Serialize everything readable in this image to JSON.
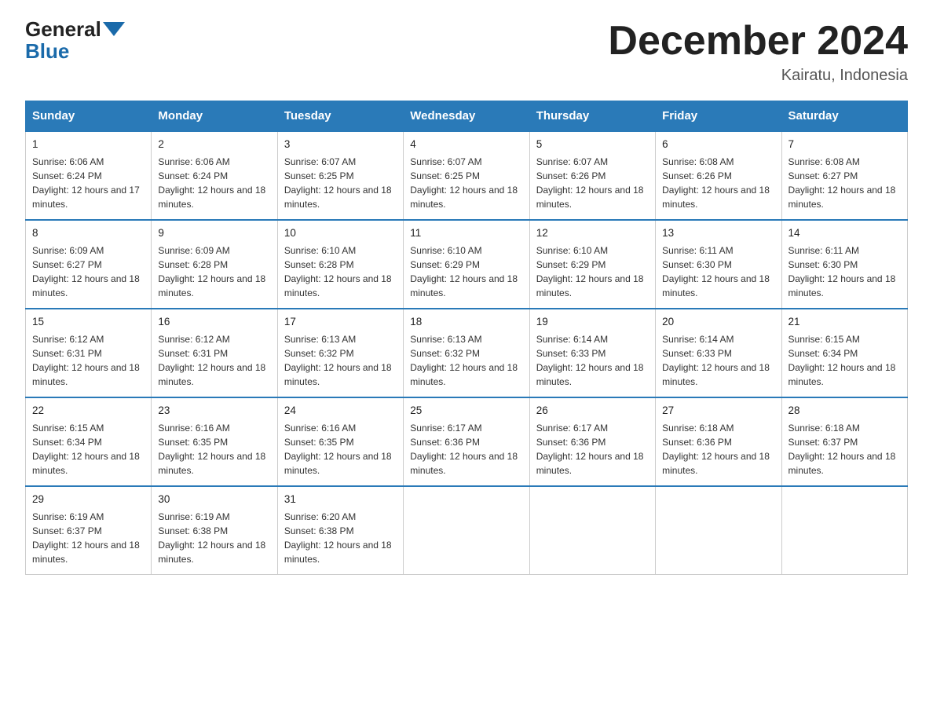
{
  "logo": {
    "general": "General",
    "blue": "Blue"
  },
  "title": "December 2024",
  "subtitle": "Kairatu, Indonesia",
  "weekdays": [
    "Sunday",
    "Monday",
    "Tuesday",
    "Wednesday",
    "Thursday",
    "Friday",
    "Saturday"
  ],
  "weeks": [
    [
      {
        "day": "1",
        "sunrise": "6:06 AM",
        "sunset": "6:24 PM",
        "daylight": "12 hours and 17 minutes."
      },
      {
        "day": "2",
        "sunrise": "6:06 AM",
        "sunset": "6:24 PM",
        "daylight": "12 hours and 18 minutes."
      },
      {
        "day": "3",
        "sunrise": "6:07 AM",
        "sunset": "6:25 PM",
        "daylight": "12 hours and 18 minutes."
      },
      {
        "day": "4",
        "sunrise": "6:07 AM",
        "sunset": "6:25 PM",
        "daylight": "12 hours and 18 minutes."
      },
      {
        "day": "5",
        "sunrise": "6:07 AM",
        "sunset": "6:26 PM",
        "daylight": "12 hours and 18 minutes."
      },
      {
        "day": "6",
        "sunrise": "6:08 AM",
        "sunset": "6:26 PM",
        "daylight": "12 hours and 18 minutes."
      },
      {
        "day": "7",
        "sunrise": "6:08 AM",
        "sunset": "6:27 PM",
        "daylight": "12 hours and 18 minutes."
      }
    ],
    [
      {
        "day": "8",
        "sunrise": "6:09 AM",
        "sunset": "6:27 PM",
        "daylight": "12 hours and 18 minutes."
      },
      {
        "day": "9",
        "sunrise": "6:09 AM",
        "sunset": "6:28 PM",
        "daylight": "12 hours and 18 minutes."
      },
      {
        "day": "10",
        "sunrise": "6:10 AM",
        "sunset": "6:28 PM",
        "daylight": "12 hours and 18 minutes."
      },
      {
        "day": "11",
        "sunrise": "6:10 AM",
        "sunset": "6:29 PM",
        "daylight": "12 hours and 18 minutes."
      },
      {
        "day": "12",
        "sunrise": "6:10 AM",
        "sunset": "6:29 PM",
        "daylight": "12 hours and 18 minutes."
      },
      {
        "day": "13",
        "sunrise": "6:11 AM",
        "sunset": "6:30 PM",
        "daylight": "12 hours and 18 minutes."
      },
      {
        "day": "14",
        "sunrise": "6:11 AM",
        "sunset": "6:30 PM",
        "daylight": "12 hours and 18 minutes."
      }
    ],
    [
      {
        "day": "15",
        "sunrise": "6:12 AM",
        "sunset": "6:31 PM",
        "daylight": "12 hours and 18 minutes."
      },
      {
        "day": "16",
        "sunrise": "6:12 AM",
        "sunset": "6:31 PM",
        "daylight": "12 hours and 18 minutes."
      },
      {
        "day": "17",
        "sunrise": "6:13 AM",
        "sunset": "6:32 PM",
        "daylight": "12 hours and 18 minutes."
      },
      {
        "day": "18",
        "sunrise": "6:13 AM",
        "sunset": "6:32 PM",
        "daylight": "12 hours and 18 minutes."
      },
      {
        "day": "19",
        "sunrise": "6:14 AM",
        "sunset": "6:33 PM",
        "daylight": "12 hours and 18 minutes."
      },
      {
        "day": "20",
        "sunrise": "6:14 AM",
        "sunset": "6:33 PM",
        "daylight": "12 hours and 18 minutes."
      },
      {
        "day": "21",
        "sunrise": "6:15 AM",
        "sunset": "6:34 PM",
        "daylight": "12 hours and 18 minutes."
      }
    ],
    [
      {
        "day": "22",
        "sunrise": "6:15 AM",
        "sunset": "6:34 PM",
        "daylight": "12 hours and 18 minutes."
      },
      {
        "day": "23",
        "sunrise": "6:16 AM",
        "sunset": "6:35 PM",
        "daylight": "12 hours and 18 minutes."
      },
      {
        "day": "24",
        "sunrise": "6:16 AM",
        "sunset": "6:35 PM",
        "daylight": "12 hours and 18 minutes."
      },
      {
        "day": "25",
        "sunrise": "6:17 AM",
        "sunset": "6:36 PM",
        "daylight": "12 hours and 18 minutes."
      },
      {
        "day": "26",
        "sunrise": "6:17 AM",
        "sunset": "6:36 PM",
        "daylight": "12 hours and 18 minutes."
      },
      {
        "day": "27",
        "sunrise": "6:18 AM",
        "sunset": "6:36 PM",
        "daylight": "12 hours and 18 minutes."
      },
      {
        "day": "28",
        "sunrise": "6:18 AM",
        "sunset": "6:37 PM",
        "daylight": "12 hours and 18 minutes."
      }
    ],
    [
      {
        "day": "29",
        "sunrise": "6:19 AM",
        "sunset": "6:37 PM",
        "daylight": "12 hours and 18 minutes."
      },
      {
        "day": "30",
        "sunrise": "6:19 AM",
        "sunset": "6:38 PM",
        "daylight": "12 hours and 18 minutes."
      },
      {
        "day": "31",
        "sunrise": "6:20 AM",
        "sunset": "6:38 PM",
        "daylight": "12 hours and 18 minutes."
      },
      null,
      null,
      null,
      null
    ]
  ]
}
